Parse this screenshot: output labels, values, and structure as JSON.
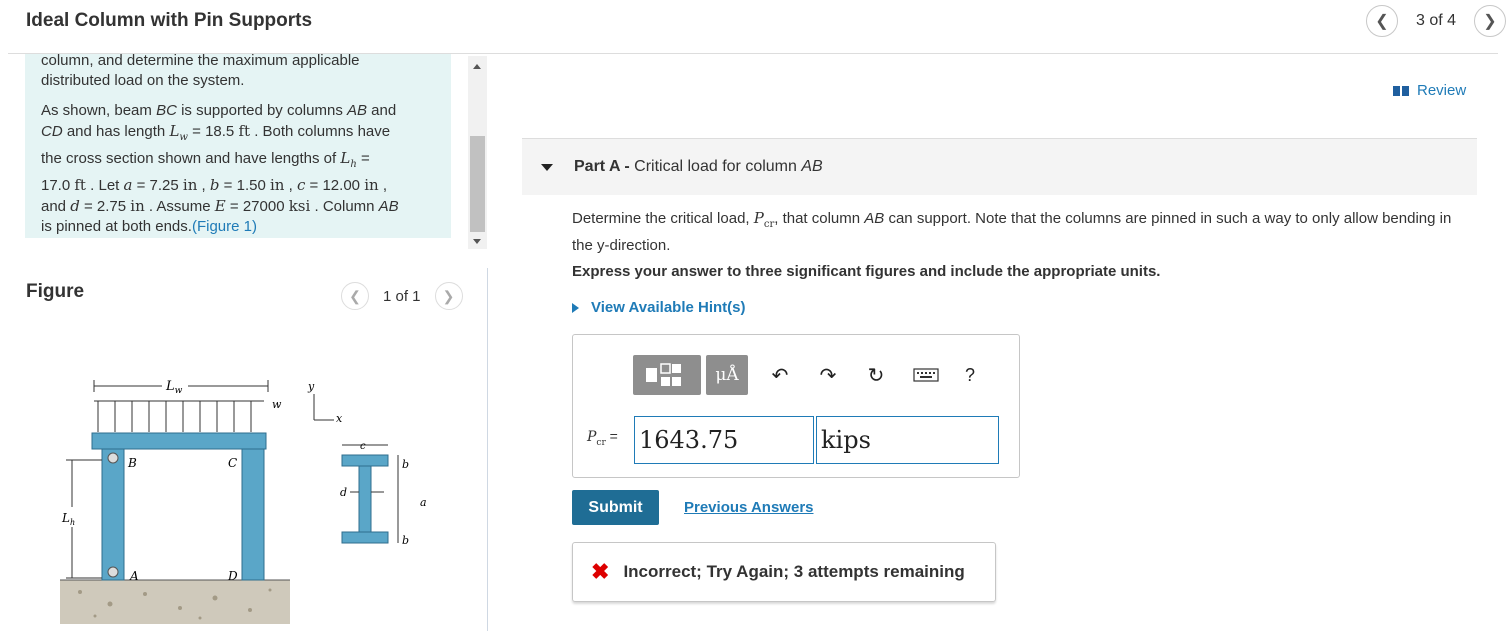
{
  "header": {
    "title": "Ideal Column with Pin Supports",
    "page_label": "3 of 4"
  },
  "intro": {
    "p1_line1": "column, and determine the maximum applicable",
    "p1_line2": "distributed load on the system.",
    "p2": {
      "t1": "As shown, beam ",
      "bc": "BC",
      "t2": " is supported by columns ",
      "ab": "AB",
      "t3": " and",
      "cd": "CD",
      "t4": " and has length ",
      "lw_sym": "L",
      "lw_sub": "w",
      "t5": " = 18.5 ",
      "ft1": "ft",
      "t6": " . Both columns have",
      "t7": "the cross section shown and have lengths of ",
      "lh_sym": "L",
      "lh_sub": "h",
      "t8": " =",
      "t9": "17.0 ",
      "ft2": "ft",
      "t10": " . Let ",
      "a": "a",
      "t11": " = 7.25 ",
      "in1": "in",
      "t12": " , ",
      "b": "b",
      "t13": " = 1.50 ",
      "in2": "in",
      "t14": " , ",
      "c": "c",
      "t15": " = 12.00 ",
      "in3": "in",
      "t16": " ,",
      "t17": "and ",
      "d": "d",
      "t18": " = 2.75 ",
      "in4": "in",
      "t19": " . Assume ",
      "e": "E",
      "t20": " = 27000 ",
      "ksi": "ksi",
      "t21": " . Column ",
      "ab2": "AB",
      "t22": "is pinned at both ends.",
      "fig_link": "(Figure 1)"
    }
  },
  "figure": {
    "heading": "Figure",
    "page_label": "1 of 1",
    "labels": {
      "lw": "L",
      "lw_sub": "w",
      "w": "w",
      "y": "y",
      "x": "x",
      "b_pt": "B",
      "c_pt": "C",
      "a_pt": "A",
      "d_pt": "D",
      "lh": "L",
      "lh_sub": "h",
      "c_dim": "c",
      "b_dim1": "b",
      "a_dim": "a",
      "b_dim2": "b",
      "d_dim": "d"
    }
  },
  "review_label": "Review",
  "part": {
    "prefix": "Part A -",
    "title": " Critical load for column ",
    "ab": "AB"
  },
  "question": {
    "t1": "Determine the critical load, ",
    "p": "P",
    "cr": "cr",
    "t2": ", that column ",
    "ab": "AB",
    "t3": " can support. Note that the columns are pinned in such a way to only allow bending in the y-direction."
  },
  "instruction": "Express your answer to three significant figures and include the appropriate units.",
  "hint_label": "View Available Hint(s)",
  "toolbar": {
    "units_label": "μÅ",
    "help_label": "?"
  },
  "answer": {
    "label_sym": "P",
    "label_sub": "cr",
    "label_eq": "=",
    "value": "1643.75",
    "unit": "kips"
  },
  "submit_label": "Submit",
  "previous_answers_label": "Previous Answers",
  "feedback": {
    "icon": "✖",
    "message": "Incorrect; Try Again; 3 attempts remaining"
  },
  "colors": {
    "accent_blue": "#1f7bb7",
    "submit_bg": "#1f6d95",
    "intro_bg": "#e5f4f4",
    "error_red": "#dd0000",
    "column_blue": "#5aa6c8"
  }
}
